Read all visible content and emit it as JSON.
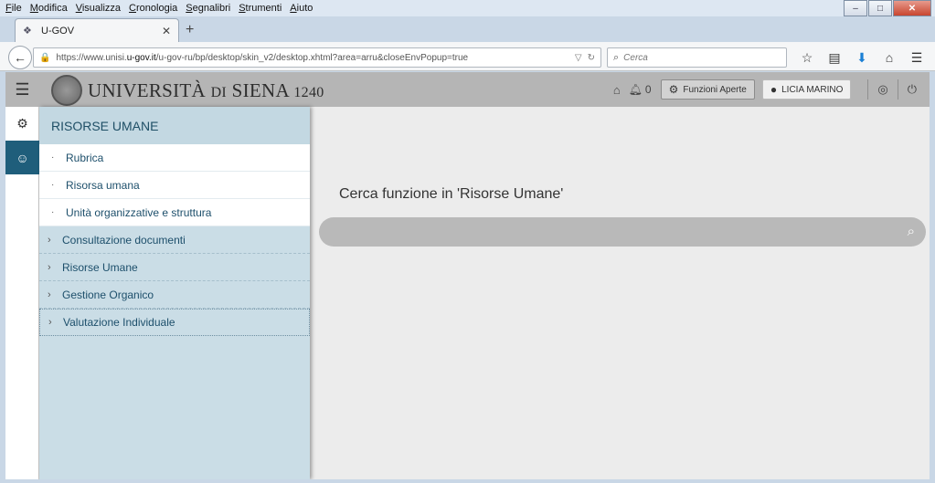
{
  "menubar": {
    "items": [
      "File",
      "Modifica",
      "Visualizza",
      "Cronologia",
      "Segnalibri",
      "Strumenti",
      "Aiuto"
    ]
  },
  "browser": {
    "tab_title": "U-GOV",
    "url_prefix": "https://www.unisi.",
    "url_domain": "u-gov.it",
    "url_suffix": "/u-gov-ru/bp/desktop/skin_v2/desktop.xhtml?area=arru&closeEnvPopup=true",
    "search_placeholder": "Cerca"
  },
  "header": {
    "logo_main": "UNIVERSITÀ",
    "logo_di": "DI",
    "logo_siena": "SIENA",
    "logo_year": "1240",
    "notifications_count": "0",
    "open_functions_label": "Funzioni Aperte",
    "user_name": "LICIA MARINO"
  },
  "sidemenu": {
    "title": "RISORSE UMANE",
    "sub_items": [
      {
        "label": "Rubrica"
      },
      {
        "label": "Risorsa umana"
      },
      {
        "label": "Unità organizzative e struttura"
      }
    ],
    "groups": [
      {
        "label": "Consultazione documenti"
      },
      {
        "label": "Risorse Umane"
      },
      {
        "label": "Gestione Organico"
      },
      {
        "label": "Valutazione Individuale"
      }
    ]
  },
  "main": {
    "search_label": "Cerca funzione in 'Risorse Umane'",
    "search_value": ""
  },
  "colors": {
    "header_bg": "#b5b5b5",
    "rail_active": "#1f5e7b",
    "menu_bg": "#cadde6",
    "menu_text": "#1d4f6b"
  }
}
